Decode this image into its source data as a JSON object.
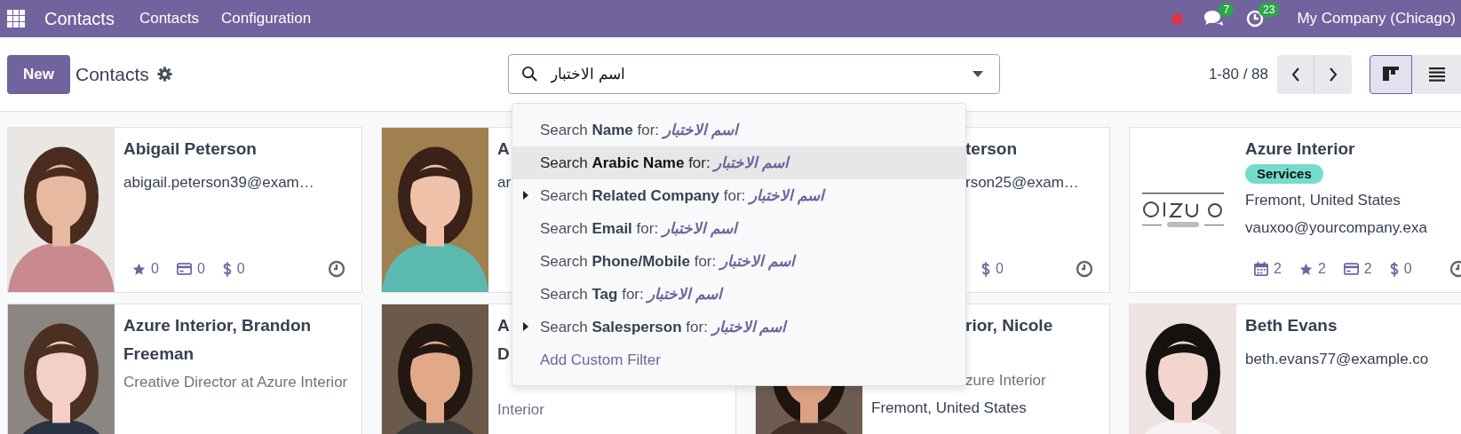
{
  "navbar": {
    "app_name": "Contacts",
    "menu": [
      {
        "label": "Contacts"
      },
      {
        "label": "Configuration"
      }
    ],
    "indicators": [
      {
        "kind": "recording"
      },
      {
        "kind": "messages",
        "count": "7"
      },
      {
        "kind": "activities",
        "count": "23"
      }
    ],
    "company": "My Company (Chicago)"
  },
  "control_panel": {
    "new_button": "New",
    "breadcrumb": "Contacts",
    "search": {
      "value": "اسم الاختبار"
    },
    "pager": "1-80 / 88",
    "views": [
      {
        "kind": "kanban",
        "selected": true
      },
      {
        "kind": "list",
        "selected": false
      }
    ]
  },
  "search_menu": [
    {
      "kind": "field",
      "text": "Search **Name** for: *اسم الاختبار*",
      "expandable": false,
      "selected": false
    },
    {
      "kind": "field",
      "text": "Search **Arabic Name** for: *اسم الاختبار*",
      "expandable": false,
      "selected": true
    },
    {
      "kind": "field",
      "text": "Search **Related Company** for: *اسم الاختبار*",
      "expandable": true,
      "selected": false
    },
    {
      "kind": "field",
      "text": "Search **Email** for: *اسم الاختبار*",
      "expandable": false,
      "selected": false
    },
    {
      "kind": "field",
      "text": "Search **Phone/Mobile** for: *اسم الاختبار*",
      "expandable": false,
      "selected": false
    },
    {
      "kind": "field",
      "text": "Search **Tag** for: *اسم الاختبار*",
      "expandable": false,
      "selected": false
    },
    {
      "kind": "field",
      "text": "Search **Salesperson** for: *اسم الاختبار*",
      "expandable": true,
      "selected": false
    },
    {
      "kind": "link",
      "text": "Add Custom Filter",
      "expandable": false,
      "selected": false
    }
  ],
  "cards": [
    {
      "kind": "contact",
      "picture": {
        "kind": "picture"
      },
      "lines": [
        {
          "kind": "name",
          "text": "Abigail Peterson"
        },
        {
          "kind": "email",
          "text": "abigail.peterson39@exam…"
        }
      ],
      "stats": [
        {
          "kind": "star",
          "count": "0"
        },
        {
          "kind": "card",
          "count": "0"
        },
        {
          "kind": "dollar",
          "count": "0"
        }
      ]
    },
    {
      "kind": "contact",
      "picture": {
        "kind": "picture"
      },
      "lines": [
        {
          "kind": "name",
          "text": "A"
        },
        {
          "kind": "email",
          "text": "ar"
        }
      ]
    },
    {
      "kind": "behind_menu",
      "lines": [
        {
          "kind": "name",
          "text": "terson"
        },
        {
          "kind": "email",
          "text": "rson25@exam…"
        }
      ],
      "stats": [
        {
          "kind": "dollar",
          "count": "0"
        }
      ]
    },
    {
      "kind": "company",
      "picture": {
        "kind": "picture"
      },
      "lines": [
        {
          "kind": "name",
          "text": "Azure Interior"
        },
        {
          "kind": "tag",
          "text": "Services"
        },
        {
          "kind": "address",
          "text": "Fremont, United States"
        },
        {
          "kind": "email",
          "text": "vauxoo@yourcompany.exa"
        }
      ],
      "stats": [
        {
          "kind": "calendar",
          "count": "2"
        },
        {
          "kind": "star",
          "count": "2"
        },
        {
          "kind": "card",
          "count": "2"
        },
        {
          "kind": "dollar",
          "count": "0"
        }
      ]
    },
    {
      "kind": "contact",
      "picture": {
        "kind": "picture"
      },
      "lines": [
        {
          "kind": "name",
          "text": "Azure Interior, Brandon Freeman"
        },
        {
          "kind": "job",
          "text": "Creative Director at Azure Interior"
        }
      ]
    },
    {
      "kind": "contact",
      "picture": {
        "kind": "picture"
      },
      "lines": [
        {
          "kind": "name",
          "text": "A"
        },
        {
          "kind": "name",
          "text": "D"
        },
        {
          "kind": "job",
          "text": "Interior"
        }
      ]
    },
    {
      "kind": "behind_menu",
      "picture": {
        "kind": "picture"
      },
      "lines": [
        {
          "kind": "name",
          "text": "rior, Nicole"
        },
        {
          "kind": "job",
          "text": "zure Interior"
        },
        {
          "kind": "address",
          "text": "Fremont, United States"
        }
      ]
    },
    {
      "kind": "contact",
      "picture": {
        "kind": "picture"
      },
      "lines": [
        {
          "kind": "name",
          "text": "Beth Evans"
        },
        {
          "kind": "email",
          "text": "beth.evans77@example.co"
        }
      ]
    }
  ]
}
